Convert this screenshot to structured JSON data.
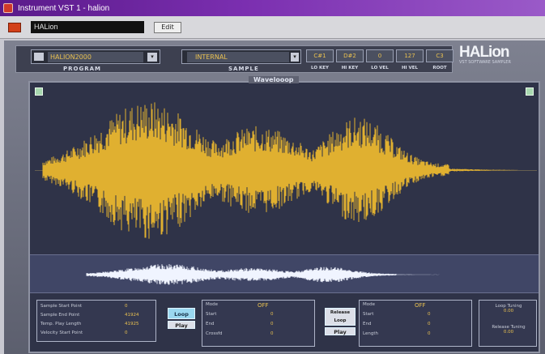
{
  "window": {
    "title": "Instrument VST 1 - halion"
  },
  "plugin_bar": {
    "name": "HALion",
    "edit_label": "Edit"
  },
  "program": {
    "value": "HALION2000",
    "label": "PROGRAM"
  },
  "sample": {
    "value": "INTERNAL",
    "label": "SAMPLE",
    "arrow": "▾"
  },
  "params": [
    {
      "value": "C#1",
      "label": "LO KEY"
    },
    {
      "value": "D#2",
      "label": "HI KEY"
    },
    {
      "value": "0",
      "label": "LO VEL"
    },
    {
      "value": "127",
      "label": "HI VEL"
    },
    {
      "value": "C3",
      "label": "ROOT"
    }
  ],
  "brand": {
    "logo": "HALion",
    "subtitle": "VST SOFTWARE SAMPLER"
  },
  "wave": {
    "title": "Wavelooop",
    "color": "#e0b030",
    "overview_color": "#f0f4ff"
  },
  "sample_info": {
    "rows": [
      {
        "label": "Sample Start Point",
        "value": "0"
      },
      {
        "label": "Sample End Point",
        "value": "41924"
      },
      {
        "label": "Temp. Play Length",
        "value": "41925"
      },
      {
        "label": "Velocity Start Point",
        "value": "0"
      }
    ]
  },
  "loop_buttons": {
    "loop": "Loop",
    "play": "Play"
  },
  "loop_panel": {
    "title": "OFF",
    "rows": [
      {
        "label": "Mode",
        "value": ""
      },
      {
        "label": "Start",
        "value": "0"
      },
      {
        "label": "End",
        "value": "0"
      },
      {
        "label": "Crossfd",
        "value": "0"
      }
    ]
  },
  "release_buttons": {
    "release": "Release Loop",
    "play": "Play"
  },
  "release_panel": {
    "title": "OFF",
    "rows": [
      {
        "label": "Mode",
        "value": ""
      },
      {
        "label": "Start",
        "value": "0"
      },
      {
        "label": "End",
        "value": "0"
      },
      {
        "label": "Length",
        "value": "0"
      }
    ]
  },
  "tuning": {
    "rows": [
      {
        "label": "Loop Tuning",
        "value": "0.00"
      },
      {
        "label": "Release Tuning",
        "value": "0.00"
      }
    ]
  }
}
